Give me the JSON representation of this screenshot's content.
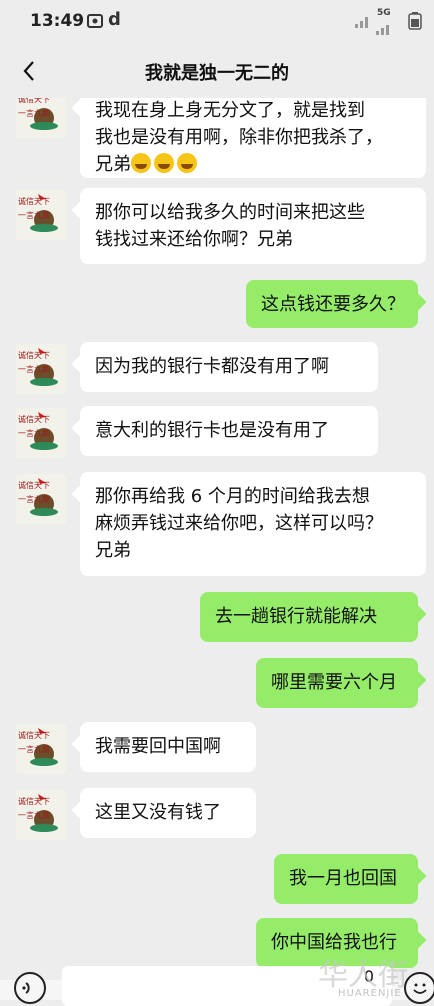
{
  "status_bar": {
    "time": "13:49",
    "app_icon_text": "d",
    "network_label": "5G"
  },
  "header": {
    "title": "我就是独一无二的"
  },
  "messages": [
    {
      "side": "in",
      "lines": [
        "我现在身上身无分文了，就是找到",
        "我也是没有用啊，除非你把我杀了，",
        "兄弟"
      ],
      "emoji_count": 3
    },
    {
      "side": "in",
      "lines": [
        "那你可以给我多久的时间来把这些",
        "钱找过来还给你啊？兄弟"
      ]
    },
    {
      "side": "out",
      "lines": [
        "这点钱还要多久？"
      ]
    },
    {
      "side": "in",
      "lines": [
        "因为我的银行卡都没有用了啊"
      ]
    },
    {
      "side": "in",
      "lines": [
        "意大利的银行卡也是没有用了"
      ]
    },
    {
      "side": "in",
      "lines": [
        "那你再给我 6 个月的时间给我去想",
        "麻烦弄钱过来给你吧，这样可以吗？",
        "兄弟"
      ]
    },
    {
      "side": "out",
      "lines": [
        "去一趟银行就能解决"
      ]
    },
    {
      "side": "out",
      "lines": [
        "哪里需要六个月"
      ]
    },
    {
      "side": "in",
      "lines": [
        "我需要回中国啊"
      ]
    },
    {
      "side": "in",
      "lines": [
        "这里又没有钱了"
      ]
    },
    {
      "side": "out",
      "lines": [
        "我一月也回国"
      ]
    },
    {
      "side": "out",
      "lines": [
        "你中国给我也行"
      ]
    }
  ],
  "avatar": {
    "text_line1": "诚信天下",
    "text_line2": "一言九鼎"
  },
  "watermark": {
    "cn": "华人街",
    "en": "HUARENJIE"
  },
  "colors": {
    "background": "#ededed",
    "incoming_bubble": "#ffffff",
    "outgoing_bubble": "#95ec69"
  }
}
